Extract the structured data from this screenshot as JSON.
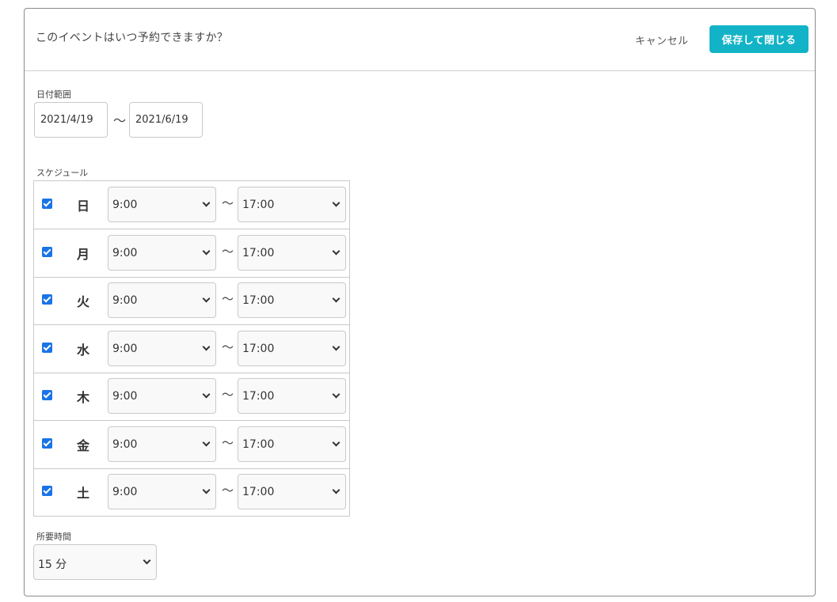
{
  "header": {
    "title": "このイベントはいつ予約できますか？",
    "cancel_label": "キャンセル",
    "save_label": "保存して閉じる"
  },
  "date_range": {
    "label": "日付範囲",
    "start": "2021/4/19",
    "separator": "〜",
    "end": "2021/6/19"
  },
  "schedule": {
    "label": "スケジュール",
    "separator": "〜",
    "rows": [
      {
        "day": "日",
        "checked": true,
        "start": "9:00",
        "end": "17:00"
      },
      {
        "day": "月",
        "checked": true,
        "start": "9:00",
        "end": "17:00"
      },
      {
        "day": "火",
        "checked": true,
        "start": "9:00",
        "end": "17:00"
      },
      {
        "day": "水",
        "checked": true,
        "start": "9:00",
        "end": "17:00"
      },
      {
        "day": "木",
        "checked": true,
        "start": "9:00",
        "end": "17:00"
      },
      {
        "day": "金",
        "checked": true,
        "start": "9:00",
        "end": "17:00"
      },
      {
        "day": "土",
        "checked": true,
        "start": "9:00",
        "end": "17:00"
      }
    ]
  },
  "duration": {
    "label": "所要時間",
    "value": "15 分"
  },
  "colors": {
    "accent": "#12b3c6",
    "checkbox": "#1a73e8"
  }
}
